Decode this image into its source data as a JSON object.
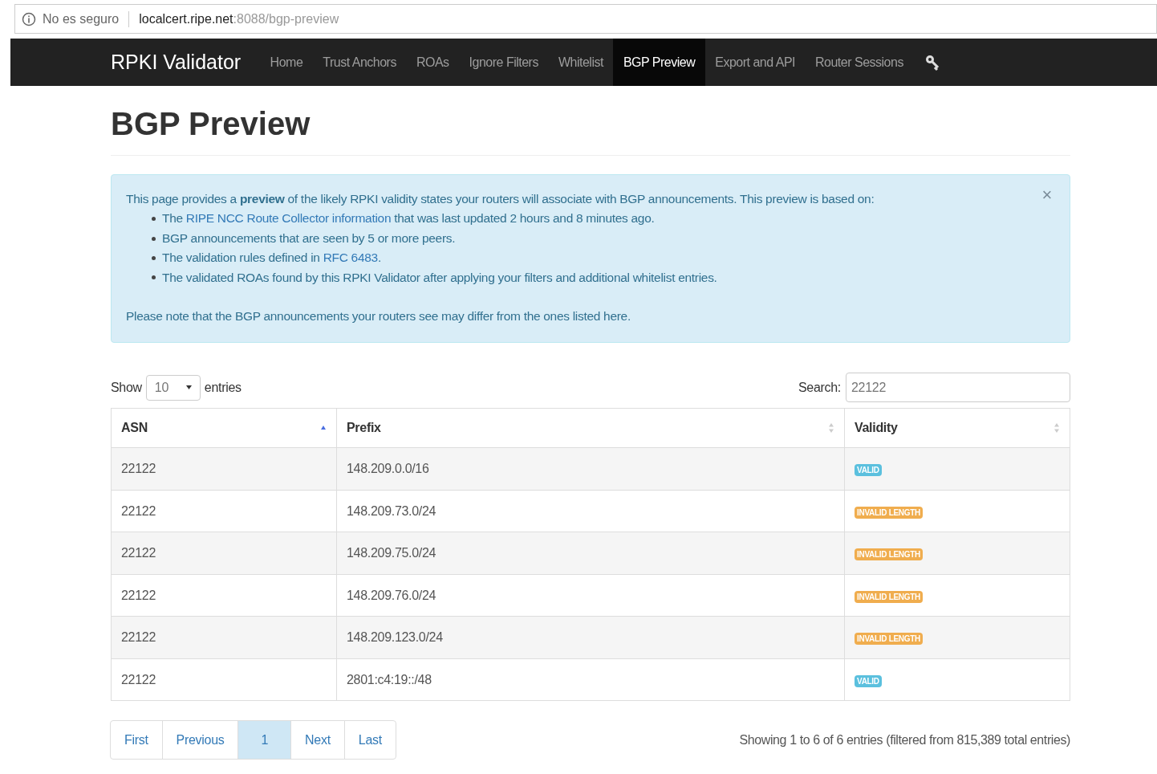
{
  "browser": {
    "security": "No es seguro",
    "host": "localcert.ripe.net",
    "path": ":8088/bgp-preview"
  },
  "navbar": {
    "brand": "RPKI Validator",
    "items": [
      {
        "label": "Home",
        "selected": false
      },
      {
        "label": "Trust Anchors",
        "selected": false
      },
      {
        "label": "ROAs",
        "selected": false
      },
      {
        "label": "Ignore Filters",
        "selected": false
      },
      {
        "label": "Whitelist",
        "selected": false
      },
      {
        "label": "BGP Preview",
        "selected": true
      },
      {
        "label": "Export and API",
        "selected": false
      },
      {
        "label": "Router Sessions",
        "selected": false
      }
    ]
  },
  "page_title": "BGP Preview",
  "alert": {
    "intro": "This page provides a **preview** of the likely RPKI validity states your routers will associate with BGP announcements. This preview is based on:",
    "bullets": [
      {
        "before": "The ",
        "link": "RIPE NCC Route Collector information",
        "after": " that was last updated 2 hours and 8 minutes ago."
      },
      {
        "before": "BGP announcements that are seen by 5 or more peers."
      },
      {
        "before": "The validation rules defined in ",
        "link": "RFC 6483",
        "after": "."
      },
      {
        "before": "The validated ROAs found by this RPKI Validator after applying your filters and additional whitelist entries."
      }
    ],
    "note": "Please note that the BGP announcements your routers see may differ from the ones listed here.",
    "close": "×"
  },
  "length": {
    "label_before": "Show",
    "value": "10",
    "label_after": "entries"
  },
  "search": {
    "label": "Search:",
    "value": "22122"
  },
  "table": {
    "columns": [
      {
        "label": "ASN",
        "sorted": true
      },
      {
        "label": "Prefix",
        "sorted": false
      },
      {
        "label": "Validity",
        "sorted": false
      }
    ],
    "rows": [
      {
        "asn": "22122",
        "prefix": "148.209.0.0/16",
        "validity": "VALID",
        "kind": "valid"
      },
      {
        "asn": "22122",
        "prefix": "148.209.73.0/24",
        "validity": "INVALID LENGTH",
        "kind": "invalid"
      },
      {
        "asn": "22122",
        "prefix": "148.209.75.0/24",
        "validity": "INVALID LENGTH",
        "kind": "invalid"
      },
      {
        "asn": "22122",
        "prefix": "148.209.76.0/24",
        "validity": "INVALID LENGTH",
        "kind": "invalid"
      },
      {
        "asn": "22122",
        "prefix": "148.209.123.0/24",
        "validity": "INVALID LENGTH",
        "kind": "invalid"
      },
      {
        "asn": "22122",
        "prefix": "2801:c4:19::/48",
        "validity": "VALID",
        "kind": "valid"
      }
    ]
  },
  "pagination": [
    {
      "label": "First",
      "selected": false
    },
    {
      "label": "Previous",
      "selected": false
    },
    {
      "label": "1",
      "selected": true
    },
    {
      "label": "Next",
      "selected": false
    },
    {
      "label": "Last",
      "selected": false
    }
  ],
  "info": "Showing 1 to 6 of 6 entries (filtered from 815,389 total entries)"
}
